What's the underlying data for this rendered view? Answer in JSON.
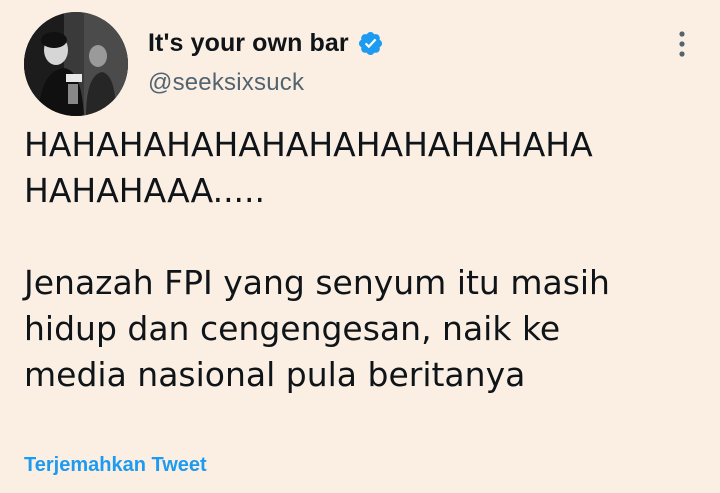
{
  "author": {
    "display_name": "It's your own bar",
    "handle": "@seeksixsuck",
    "verified": true,
    "avatar_icon": "profile-photo"
  },
  "tweet": {
    "line1": "HAHAHAHAHAHAHAHAHAHAHAHA",
    "line2": "HAHAHAAA.....",
    "line3": "Jenazah FPI yang senyum itu masih",
    "line4": "hidup dan cengengesan, naik ke",
    "line5": "media nasional pula beritanya"
  },
  "actions": {
    "translate_label": "Terjemahkan Tweet",
    "more_icon": "more-vertical-icon"
  },
  "colors": {
    "background": "#fbefe3",
    "text": "#0f1419",
    "secondary": "#536471",
    "accent": "#1d9bf0"
  }
}
